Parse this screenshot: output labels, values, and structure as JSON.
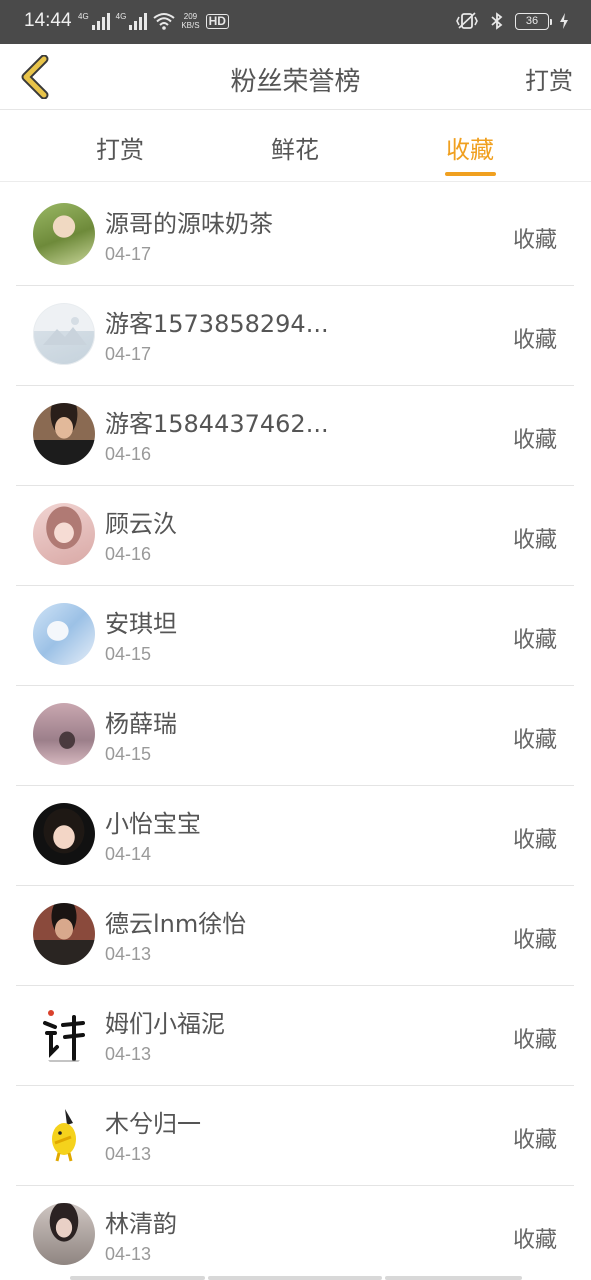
{
  "status_bar": {
    "time": "14:44",
    "net_tag_1": "4G",
    "net_tag_2": "4G",
    "speed_value": "209",
    "speed_unit": "KB/S",
    "hd_label": "HD",
    "battery_level": "36",
    "icons": [
      "signal-icon",
      "signal-icon",
      "wifi-icon",
      "hd-icon",
      "vibrate-icon",
      "bluetooth-icon",
      "battery-icon",
      "charging-icon"
    ]
  },
  "header": {
    "back_icon": "chevron-left-icon",
    "title": "粉丝荣誉榜",
    "action": "打赏"
  },
  "tabs": {
    "items": [
      {
        "label": "打赏"
      },
      {
        "label": "鲜花"
      },
      {
        "label": "收藏"
      }
    ],
    "active_index": 2
  },
  "colors": {
    "accent": "#f0a020",
    "status_bar": "#4a4a4a",
    "text": "#555555",
    "subtext": "#999999",
    "back_icon": "#e8c44a"
  },
  "list": {
    "items": [
      {
        "name": "源哥的源味奶茶",
        "date": "04-17",
        "type": "收藏"
      },
      {
        "name": "游客1573858294...",
        "date": "04-17",
        "type": "收藏"
      },
      {
        "name": "游客1584437462...",
        "date": "04-16",
        "type": "收藏"
      },
      {
        "name": "顾云汣",
        "date": "04-16",
        "type": "收藏"
      },
      {
        "name": "安琪坦",
        "date": "04-15",
        "type": "收藏"
      },
      {
        "name": "杨薛瑞",
        "date": "04-15",
        "type": "收藏"
      },
      {
        "name": "小怡宝宝",
        "date": "04-14",
        "type": "收藏"
      },
      {
        "name": "德云lnm徐怡",
        "date": "04-13",
        "type": "收藏"
      },
      {
        "name": "姆们小福泥",
        "date": "04-13",
        "type": "收藏"
      },
      {
        "name": "木兮归一",
        "date": "04-13",
        "type": "收藏"
      },
      {
        "name": "林清韵",
        "date": "04-13",
        "type": "收藏"
      }
    ]
  }
}
